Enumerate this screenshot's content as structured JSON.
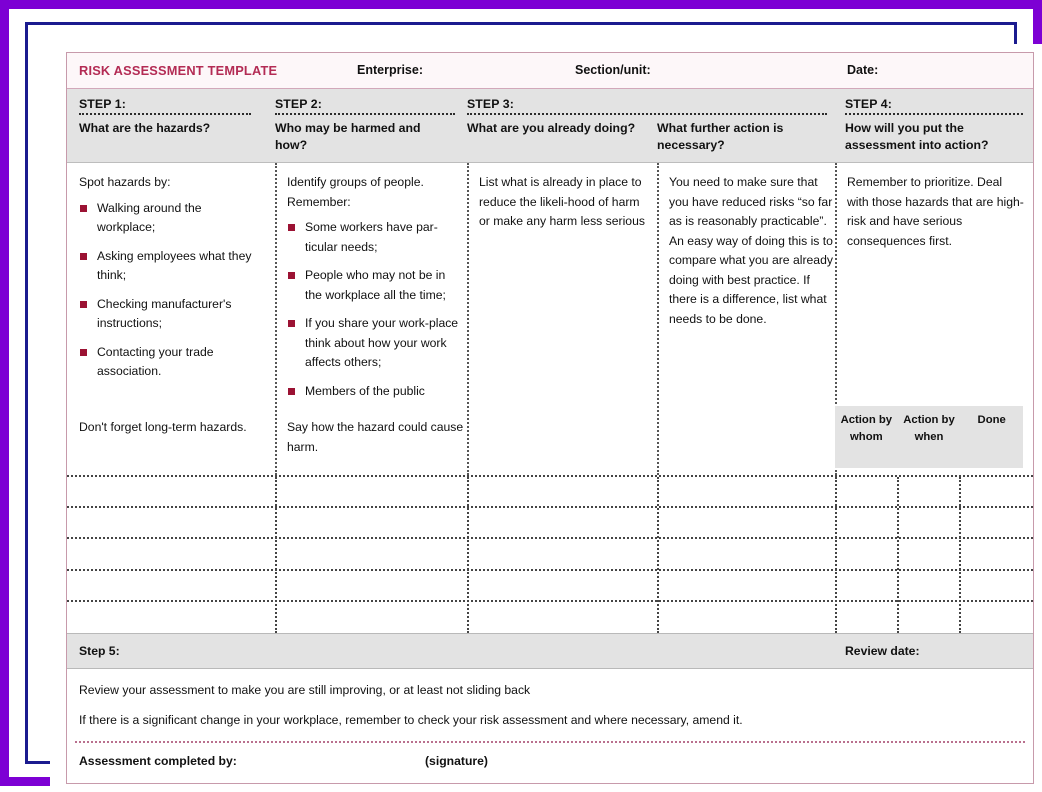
{
  "document": {
    "title": "RISK ASSESSMENT TEMPLATE",
    "fields": {
      "enterprise": "Enterprise:",
      "section_unit": "Section/unit:",
      "date": "Date:"
    }
  },
  "colors": {
    "title": "#b32b54",
    "bullet": "#9b1233",
    "band": "#e3e3e3",
    "table_border": "#c79aab",
    "outer_frame": "#7d00d4",
    "inner_frame": "#1b1b8f"
  },
  "steps": [
    {
      "number": "STEP 1:",
      "question": "What are the hazards?",
      "intro": "Spot hazards by:",
      "bullets": [
        "Walking around the workplace;",
        "Asking employees what they think;",
        "Checking manufacturer's instructions;",
        "Contacting your trade association."
      ],
      "note": "Don't forget long-term hazards."
    },
    {
      "number": "STEP 2:",
      "question": "Who may be harmed and how?",
      "intro": "Identify groups of people. Remember:",
      "bullets": [
        "Some workers have par-ticular needs;",
        "People who may not be in the workplace all the time;",
        "If you share your work-place think about how your work affects others;",
        "Members of the public"
      ],
      "note": "Say how the hazard could cause harm."
    },
    {
      "number": "STEP 3:",
      "question": "What are you already doing?",
      "question_b": "What further action is necessary?",
      "body": "List what is already in place to reduce the likeli-hood of harm or make any harm less serious",
      "body_b": "You need to make sure that you have reduced risks “so far as is reasonably practicable”. An easy way of doing this is to compare what you are already doing with best practice. If there is a difference, list what needs to be done."
    },
    {
      "number": "STEP 4:",
      "question": "How will you put the assessment into action?",
      "body": "Remember to prioritize. Deal with those hazards that are high-risk and have serious consequences first.",
      "action_columns": [
        "Action by whom",
        "Action by when",
        "Done"
      ]
    }
  ],
  "step5": {
    "label": "Step 5:",
    "review_date_label": "Review date:",
    "line1": "Review your assessment to make you are still improving, or at least not sliding back",
    "line2": "If there is a significant change in your workplace, remember to check your risk assessment and where necessary, amend it.",
    "completed_by_label": "Assessment completed by:",
    "signature_label": "(signature)"
  },
  "grid": {
    "row_count": 5
  }
}
